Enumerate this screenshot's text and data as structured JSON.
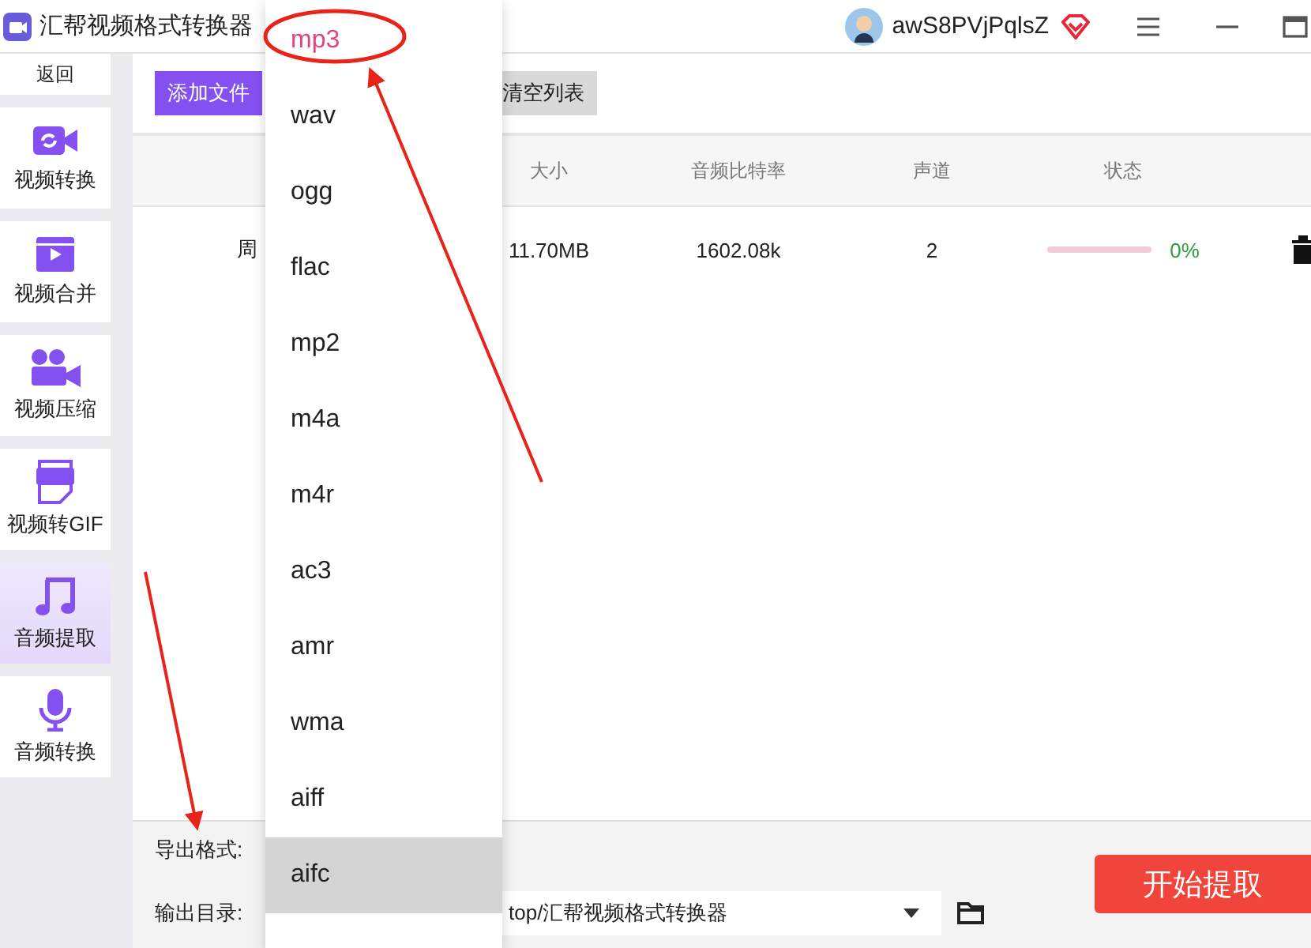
{
  "window": {
    "title": "汇帮视频格式转换器",
    "user": "awS8PVjPqlsZ"
  },
  "sidebar": {
    "back": "返回",
    "items": [
      {
        "label": "视频转换",
        "kind": "convert",
        "selected": false
      },
      {
        "label": "视频合并",
        "kind": "merge",
        "selected": false
      },
      {
        "label": "视频压缩",
        "kind": "compress",
        "selected": false
      },
      {
        "label": "视频转GIF",
        "kind": "gif",
        "selected": false
      },
      {
        "label": "音频提取",
        "kind": "music",
        "selected": true
      },
      {
        "label": "音频转换",
        "kind": "mic",
        "selected": false
      }
    ]
  },
  "toolbar": {
    "add_button": "添加文件",
    "clear_button": "清空列表"
  },
  "table": {
    "columns": [
      "",
      "大小",
      "音频比特率",
      "声道",
      "状态"
    ],
    "rows": [
      {
        "name": "周",
        "size": "11.70MB",
        "bitrate": "1602.08k",
        "channels": "2",
        "level": 0,
        "status": "0%"
      }
    ]
  },
  "bottom": {
    "format_label": "导出格式:",
    "output_label": "输出目录:",
    "output_dir": "top/汇帮视频格式转换器",
    "start_button": "开始提取"
  },
  "format_dropdown": [
    {
      "label": "mp3",
      "selected": true,
      "hovered": false
    },
    {
      "label": "wav",
      "selected": false,
      "hovered": false
    },
    {
      "label": "ogg",
      "selected": false,
      "hovered": false
    },
    {
      "label": "flac",
      "selected": false,
      "hovered": false
    },
    {
      "label": "mp2",
      "selected": false,
      "hovered": false
    },
    {
      "label": "m4a",
      "selected": false,
      "hovered": false
    },
    {
      "label": "m4r",
      "selected": false,
      "hovered": false
    },
    {
      "label": "ac3",
      "selected": false,
      "hovered": false
    },
    {
      "label": "amr",
      "selected": false,
      "hovered": false
    },
    {
      "label": "wma",
      "selected": false,
      "hovered": false
    },
    {
      "label": "aiff",
      "selected": false,
      "hovered": false
    },
    {
      "label": "aifc",
      "selected": false,
      "hovered": true
    }
  ]
}
